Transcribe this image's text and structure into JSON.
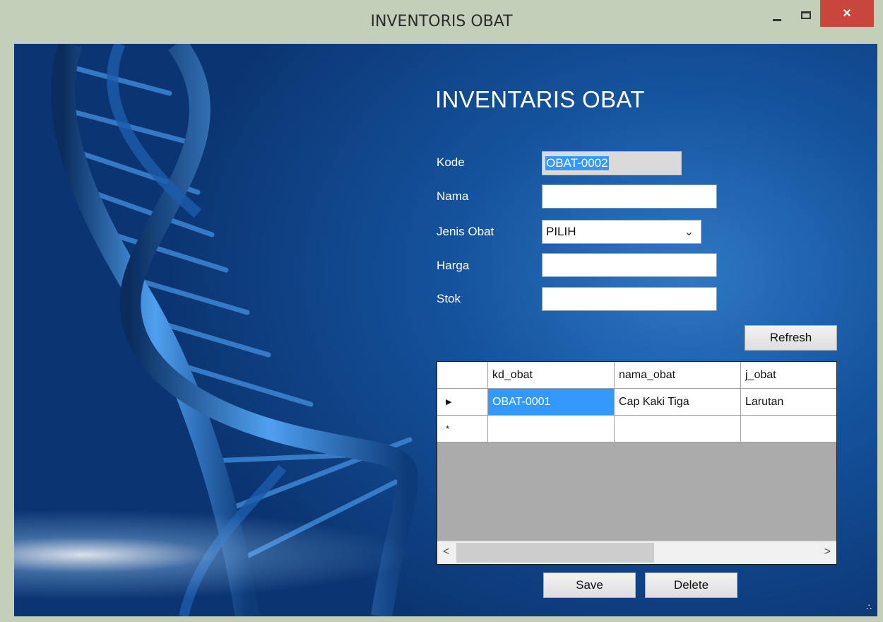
{
  "window": {
    "title": "INVENTORIS OBAT",
    "close_glyph": "×"
  },
  "form": {
    "heading": "INVENTARIS OBAT",
    "labels": {
      "kode": "Kode",
      "nama": "Nama",
      "jenis": "Jenis Obat",
      "harga": "Harga",
      "stok": "Stok"
    },
    "fields": {
      "kode": "OBAT-0002",
      "nama": "",
      "jenis": "PILIH",
      "harga": "",
      "stok": ""
    }
  },
  "buttons": {
    "refresh": "Refresh",
    "save": "Save",
    "delete": "Delete"
  },
  "grid": {
    "columns": [
      "",
      "kd_obat",
      "nama_obat",
      "j_obat"
    ],
    "rows": [
      {
        "indicator": "▶",
        "kd_obat": "OBAT-0001",
        "nama_obat": "Cap Kaki Tiga",
        "j_obat": "Larutan"
      },
      {
        "indicator": "*",
        "kd_obat": "",
        "nama_obat": "",
        "j_obat": ""
      }
    ],
    "scroll_left": "<",
    "scroll_right": ">"
  },
  "icons": [
    "minimize-icon",
    "maximize-icon",
    "close-icon",
    "dropdown-chevron-icon",
    "row-pointer-icon",
    "new-row-icon",
    "resize-grip-icon"
  ],
  "colors": {
    "accent": "#3399ff",
    "close": "#c9463d",
    "background_blue": "#15539e"
  }
}
